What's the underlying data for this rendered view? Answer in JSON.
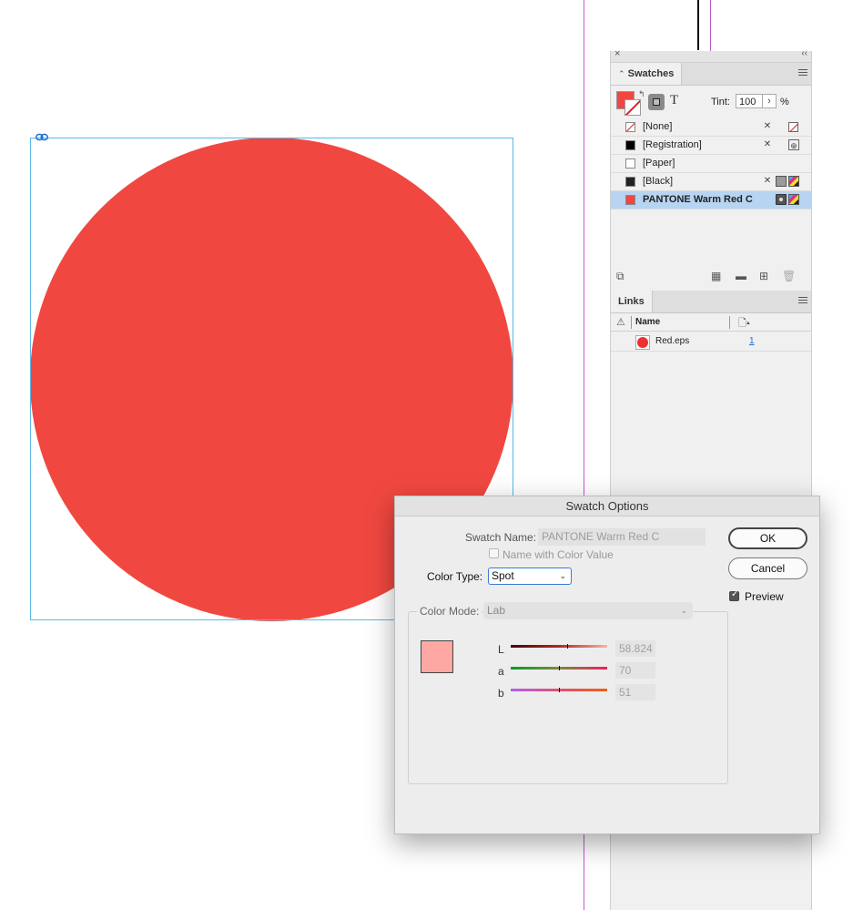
{
  "canvas": {
    "graphic_color": "#f04840",
    "frame_color": "#59b8e6"
  },
  "swatches_panel": {
    "tab_label": "Swatches",
    "tint_label": "Tint:",
    "tint_value": "100",
    "tint_unit": "%",
    "items": [
      {
        "name": "[None]",
        "chip": "none"
      },
      {
        "name": "[Registration]",
        "chip": "#000000"
      },
      {
        "name": "[Paper]",
        "chip": "#ffffff"
      },
      {
        "name": "[Black]",
        "chip": "#222222"
      },
      {
        "name": "PANTONE Warm Red C",
        "chip": "#f04840",
        "selected": true
      }
    ]
  },
  "links_panel": {
    "tab_label": "Links",
    "col_name": "Name",
    "items": [
      {
        "name": "Red.eps",
        "page": "1"
      }
    ]
  },
  "dialog": {
    "title": "Swatch Options",
    "swatch_name_label": "Swatch Name:",
    "swatch_name_value": "PANTONE Warm Red C",
    "name_with_color_label": "Name with Color Value",
    "color_type_label": "Color Type:",
    "color_type_value": "Spot",
    "color_mode_label": "Color Mode:",
    "color_mode_value": "Lab",
    "ok_label": "OK",
    "cancel_label": "Cancel",
    "preview_label": "Preview",
    "preview_checked": true,
    "preview_color": "#fda8a2",
    "sliders": [
      {
        "label": "L",
        "value": "58.824",
        "position": 0.588
      },
      {
        "label": "a",
        "value": "70",
        "position": 0.5
      },
      {
        "label": "b",
        "value": "51",
        "position": 0.5
      }
    ]
  }
}
